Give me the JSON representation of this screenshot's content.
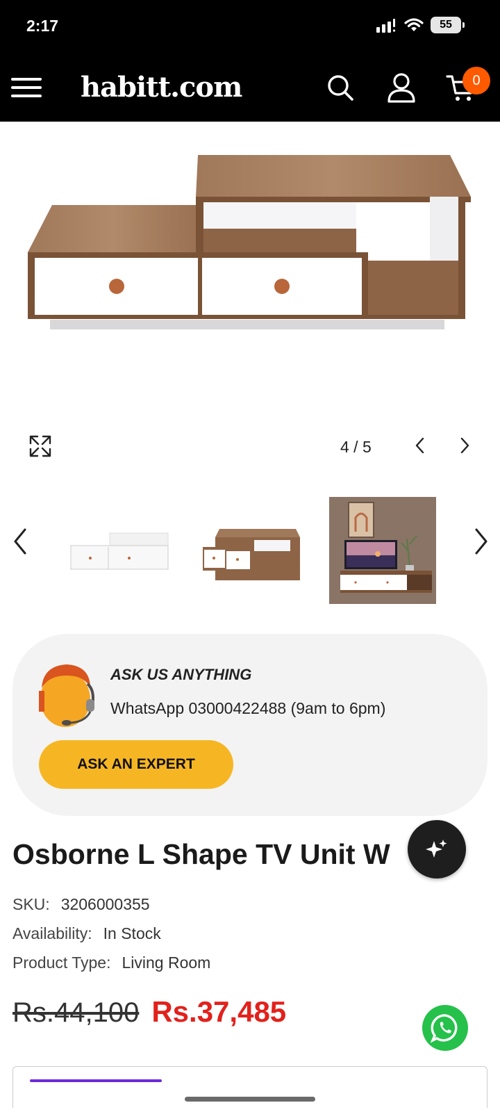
{
  "status": {
    "time": "2:17",
    "battery": "55"
  },
  "header": {
    "logo": "habitt.com",
    "cart_count": "0"
  },
  "gallery": {
    "counter": "4 / 5"
  },
  "ask": {
    "title": "ASK US ANYTHING",
    "subtitle": "WhatsApp 03000422488 (9am to 6pm)",
    "button": "ASK AN EXPERT"
  },
  "product": {
    "title": "Osborne L Shape TV Unit W",
    "sku_label": "SKU:",
    "sku": "3206000355",
    "availability_label": "Availability:",
    "availability": "In Stock",
    "type_label": "Product Type:",
    "type": "Living Room",
    "price_old": "Rs.44,100",
    "price_new": "Rs.37,485"
  },
  "colors": {
    "accent": "#f6b624",
    "price": "#e2211c",
    "badge": "#ff5a00",
    "whatsapp": "#25c14b"
  }
}
